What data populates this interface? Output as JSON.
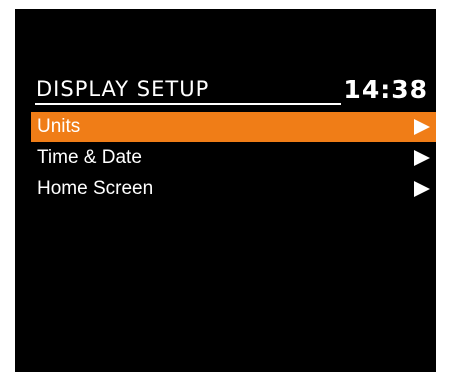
{
  "header": {
    "title": "DISPLAY SETUP",
    "time": "14:38"
  },
  "menu": {
    "selected_index": 0,
    "items": [
      {
        "label": "Units",
        "icon": "right-arrow-icon"
      },
      {
        "label": "Time & Date",
        "icon": "right-arrow-icon"
      },
      {
        "label": "Home Screen",
        "icon": "right-arrow-icon"
      }
    ]
  },
  "colors": {
    "background": "#000000",
    "highlight": "#f07d17",
    "text": "#ffffff"
  }
}
